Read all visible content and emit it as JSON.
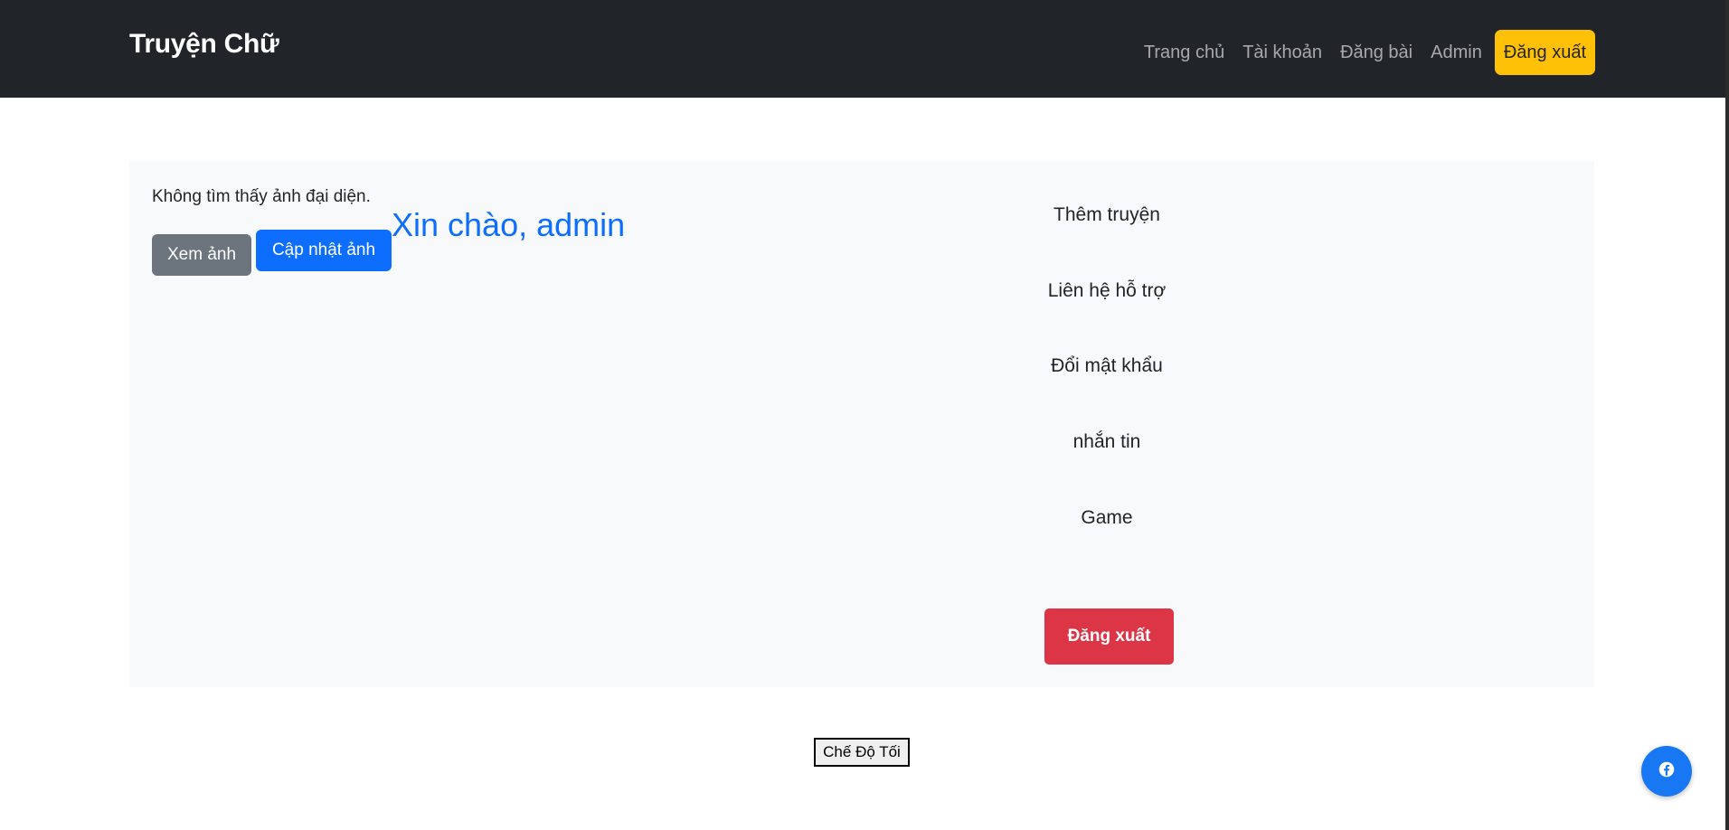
{
  "navbar": {
    "brand": "Truyện Chữ",
    "links": [
      "Trang chủ",
      "Tài khoản",
      "Đăng bài",
      "Admin"
    ],
    "logout_label": "Đăng xuất"
  },
  "profile": {
    "no_avatar_text": "Không tìm thấy ảnh đại diện.",
    "view_photo_label": "Xem ảnh",
    "update_photo_label": "Cập nhật ảnh",
    "greeting": "Xin chào, admin"
  },
  "menu": {
    "items": [
      "Thêm truyện",
      "Liên hệ hỗ trợ",
      "Đổi mật khẩu",
      "nhắn tin",
      "Game"
    ],
    "logout_label": "Đăng xuất"
  },
  "dark_mode_label": "Chế Độ Tối",
  "floating_button": {
    "icon": "facebook-icon",
    "color": "#1877f2"
  },
  "colors": {
    "navbar_bg": "#212529",
    "warning": "#ffc107",
    "primary": "#0d6efd",
    "secondary": "#6c757d",
    "danger": "#dc3545",
    "panel_bg": "#f8f9fa"
  }
}
